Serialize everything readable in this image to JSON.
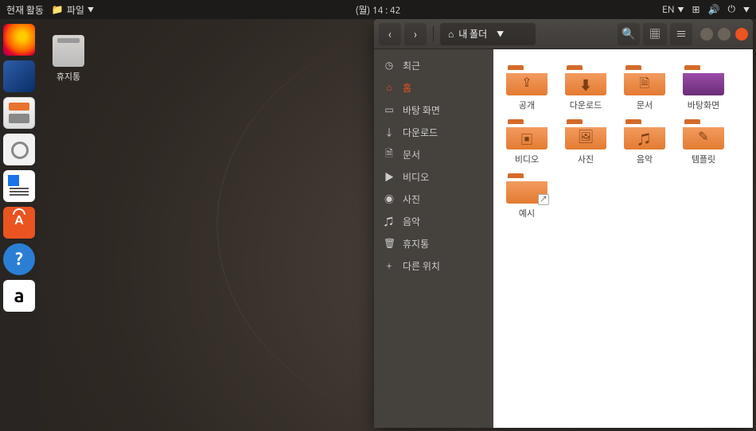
{
  "topbar": {
    "activities": "현재 활동",
    "app_menu": "파일",
    "clock": "(월) 14 : 42",
    "lang": "EN"
  },
  "desktop": {
    "trash_label": "휴지통"
  },
  "nautilus": {
    "path": "내 폴더",
    "sidebar": [
      {
        "icon": "◷",
        "label": "최근",
        "name": "recent"
      },
      {
        "icon": "⌂",
        "label": "홈",
        "name": "home",
        "active": true
      },
      {
        "icon": "▭",
        "label": "바탕 화면",
        "name": "desktop"
      },
      {
        "icon": "↓",
        "label": "다운로드",
        "name": "downloads"
      },
      {
        "icon": "🗎",
        "label": "문서",
        "name": "documents"
      },
      {
        "icon": "▶",
        "label": "비디오",
        "name": "videos"
      },
      {
        "icon": "◉",
        "label": "사진",
        "name": "pictures"
      },
      {
        "icon": "♫",
        "label": "음악",
        "name": "music"
      },
      {
        "icon": "🗑",
        "label": "휴지통",
        "name": "trash"
      },
      {
        "icon": "+",
        "label": "다른 위치",
        "name": "other"
      }
    ],
    "folders": [
      {
        "label": "공개",
        "glyph": "⇪"
      },
      {
        "label": "다운로드",
        "glyph": "⬇"
      },
      {
        "label": "문서",
        "glyph": "🗎"
      },
      {
        "label": "바탕화면",
        "glyph": "",
        "dark": true
      },
      {
        "label": "비디오",
        "glyph": "▣"
      },
      {
        "label": "사진",
        "glyph": "🖼"
      },
      {
        "label": "음악",
        "glyph": "♫"
      },
      {
        "label": "템플릿",
        "glyph": "✎"
      },
      {
        "label": "예시",
        "glyph": "",
        "link": true
      }
    ]
  }
}
